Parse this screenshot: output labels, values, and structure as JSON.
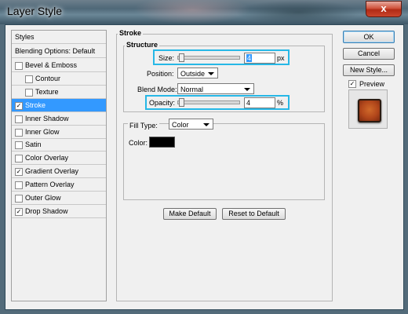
{
  "window": {
    "title": "Layer Style",
    "close_glyph": "x"
  },
  "styles_panel": {
    "header": "Styles",
    "blending_options": "Blending Options: Default",
    "items": [
      {
        "label": "Bevel & Emboss",
        "checked": false,
        "indent": false,
        "selected": false
      },
      {
        "label": "Contour",
        "checked": false,
        "indent": true,
        "selected": false
      },
      {
        "label": "Texture",
        "checked": false,
        "indent": true,
        "selected": false
      },
      {
        "label": "Stroke",
        "checked": true,
        "indent": false,
        "selected": true
      },
      {
        "label": "Inner Shadow",
        "checked": false,
        "indent": false,
        "selected": false
      },
      {
        "label": "Inner Glow",
        "checked": false,
        "indent": false,
        "selected": false
      },
      {
        "label": "Satin",
        "checked": false,
        "indent": false,
        "selected": false
      },
      {
        "label": "Color Overlay",
        "checked": false,
        "indent": false,
        "selected": false
      },
      {
        "label": "Gradient Overlay",
        "checked": true,
        "indent": false,
        "selected": false
      },
      {
        "label": "Pattern Overlay",
        "checked": false,
        "indent": false,
        "selected": false
      },
      {
        "label": "Outer Glow",
        "checked": false,
        "indent": false,
        "selected": false
      },
      {
        "label": "Drop Shadow",
        "checked": true,
        "indent": false,
        "selected": false
      }
    ]
  },
  "stroke": {
    "section_title": "Stroke",
    "structure_title": "Structure",
    "size": {
      "label": "Size:",
      "value": "4",
      "unit": "px"
    },
    "position": {
      "label": "Position:",
      "value": "Outside"
    },
    "blend_mode": {
      "label": "Blend Mode:",
      "value": "Normal"
    },
    "opacity": {
      "label": "Opacity:",
      "value": "4",
      "unit": "%"
    },
    "fill_type": {
      "label": "Fill Type:",
      "value": "Color"
    },
    "color": {
      "label": "Color:",
      "swatch": "#000000"
    },
    "make_default": "Make Default",
    "reset_default": "Reset to Default"
  },
  "actions": {
    "ok": "OK",
    "cancel": "Cancel",
    "new_style": "New Style...",
    "preview_label": "Preview",
    "preview_checked": true
  },
  "colors": {
    "highlight": "#27b8e6",
    "selection": "#3399ff"
  }
}
